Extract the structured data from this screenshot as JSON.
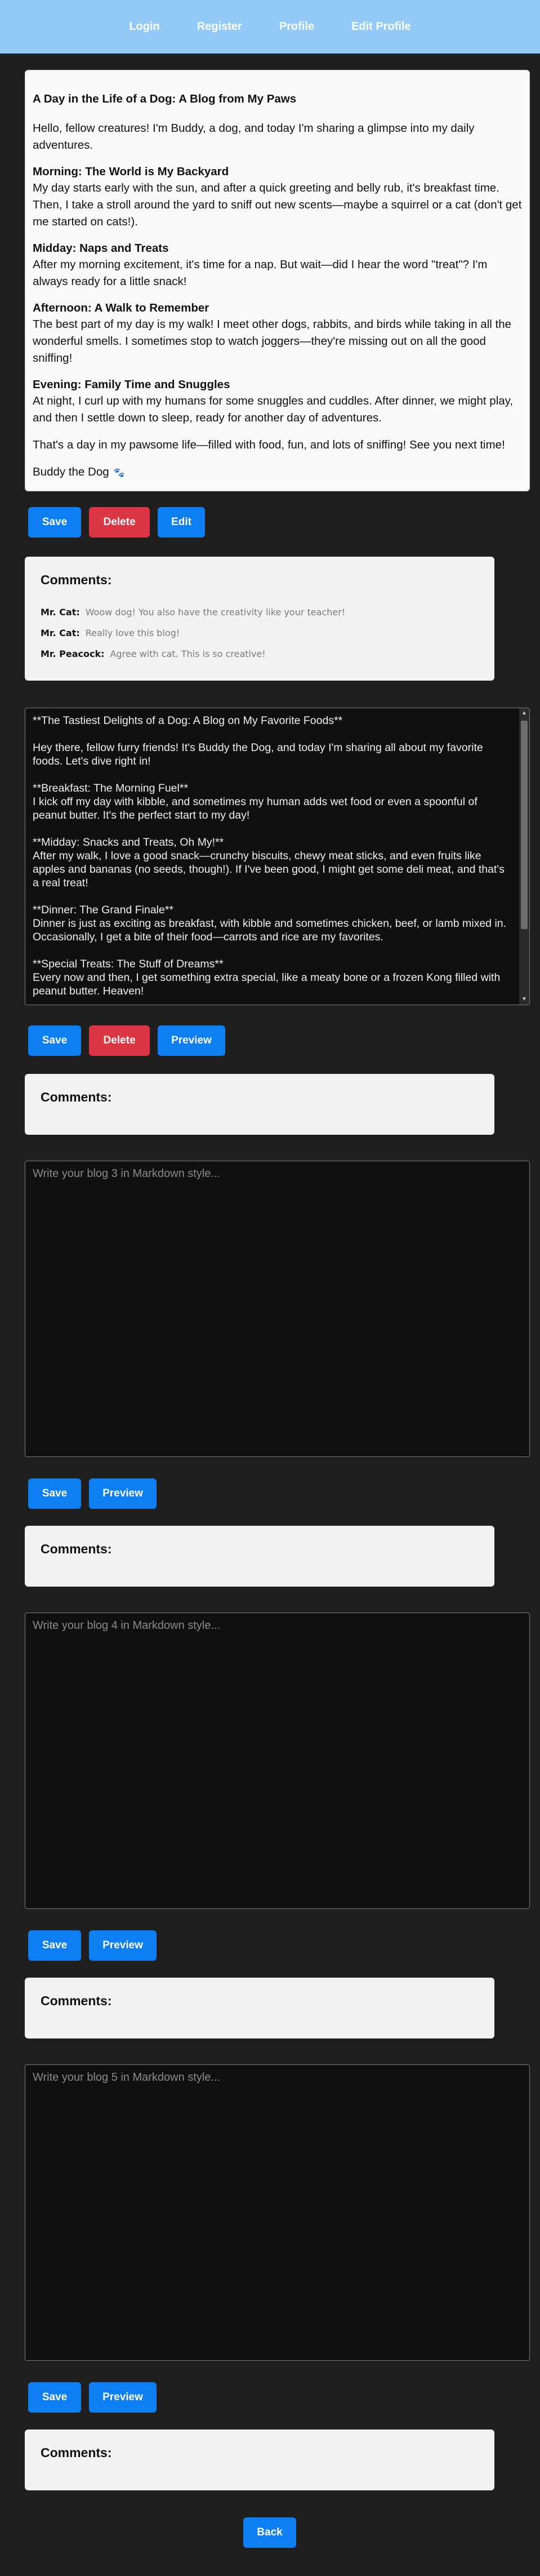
{
  "nav": {
    "login": "Login",
    "register": "Register",
    "profile": "Profile",
    "edit_profile": "Edit Profile"
  },
  "blog1": {
    "title": "A Day in the Life of a Dog: A Blog from My Paws",
    "intro": "Hello, fellow creatures! I'm Buddy, a dog, and today I'm sharing a glimpse into my daily adventures.",
    "sections": [
      {
        "heading": "Morning: The World is My Backyard",
        "text": "My day starts early with the sun, and after a quick greeting and belly rub, it's breakfast time. Then, I take a stroll around the yard to sniff out new scents—maybe a squirrel or a cat (don't get me started on cats!)."
      },
      {
        "heading": "Midday: Naps and Treats",
        "text": "After my morning excitement, it's time for a nap. But wait—did I hear the word \"treat\"? I'm always ready for a little snack!"
      },
      {
        "heading": "Afternoon: A Walk to Remember",
        "text": "The best part of my day is my walk! I meet other dogs, rabbits, and birds while taking in all the wonderful smells. I sometimes stop to watch joggers—they're missing out on all the good sniffing!"
      },
      {
        "heading": "Evening: Family Time and Snuggles",
        "text": "At night, I curl up with my humans for some snuggles and cuddles. After dinner, we might play, and then I settle down to sleep, ready for another day of adventures."
      }
    ],
    "closing": "That's a day in my pawsome life—filled with food, fun, and lots of sniffing! See you next time!",
    "signature": "Buddy the Dog",
    "paw_icon": "paw-icon"
  },
  "buttons": {
    "save": "Save",
    "delete": "Delete",
    "edit": "Edit",
    "preview": "Preview",
    "back": "Back"
  },
  "comments_title": "Comments:",
  "comments1": [
    {
      "author": "Mr. Cat:",
      "text": "Woow dog! You also have the creativity like your teacher!"
    },
    {
      "author": "Mr. Cat:",
      "text": "Really love this blog!"
    },
    {
      "author": "Mr. Peacock:",
      "text": "Agree with cat. This is so creative!"
    }
  ],
  "blog2": {
    "paragraphs": [
      "**The Tastiest Delights of a Dog: A Blog on My Favorite Foods**",
      "Hey there, fellow furry friends! It's Buddy the Dog, and today I'm sharing all about my favorite foods. Let's dive right in!",
      "**Breakfast: The Morning Fuel**\nI kick off my day with kibble, and sometimes my human adds wet food or even a spoonful of peanut butter. It's the perfect start to my day!",
      "**Midday: Snacks and Treats, Oh My!**\nAfter my walk, I love a good snack—crunchy biscuits, chewy meat sticks, and even fruits like apples and bananas (no seeds, though!). If I've been good, I might get some deli meat, and that's a real treat!",
      "**Dinner: The Grand Finale**\nDinner is just as exciting as breakfast, with kibble and sometimes chicken, beef, or lamb mixed in. Occasionally, I get a bite of their food—carrots and rice are my favorites.",
      "**Special Treats: The Stuff of Dreams**\nEvery now and then, I get something extra special, like a meaty bone or a frozen Kong filled with peanut butter. Heaven!"
    ]
  },
  "placeholders": {
    "blog3": "Write your blog 3 in Markdown style...",
    "blog4": "Write your blog 4 in Markdown style...",
    "blog5": "Write your blog 5 in Markdown style..."
  }
}
